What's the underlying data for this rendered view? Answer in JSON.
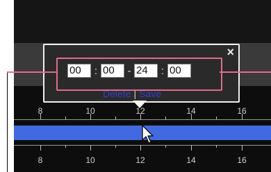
{
  "time_range_editor": {
    "start_hour": "00",
    "start_minute": "00",
    "end_hour": "24",
    "end_minute": "00",
    "colon_separator": ":",
    "range_separator": "-",
    "close_icon": "×",
    "delete_label": "Delete",
    "pipe_separator": "|",
    "save_label": "Save"
  },
  "timeline": {
    "upper_tick_labels": [
      "8",
      "10",
      "12",
      "14",
      "16"
    ],
    "lower_tick_labels": [
      "8",
      "10",
      "12",
      "14",
      "16"
    ],
    "bar_color": "#4169e0"
  },
  "icons": {
    "close": "close-icon",
    "cursor": "mouse-pointer-icon"
  },
  "colors": {
    "callout": "#e06d8a",
    "popup_border": "#f0f0f0",
    "link": "#2f43c9"
  }
}
